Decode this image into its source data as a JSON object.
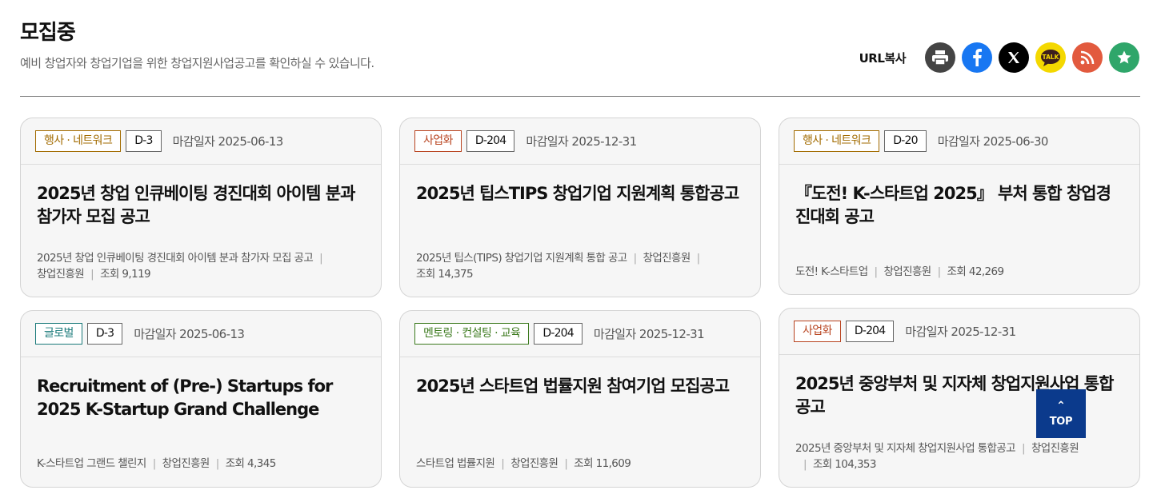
{
  "page": {
    "title": "모집중",
    "description": "예비 창업자와 창업기업을 위한 창업지원사업공고를 확인하실 수 있습니다."
  },
  "share": {
    "url_copy_label": "URL복사",
    "buttons": [
      {
        "icon": "print-icon",
        "color": "#444444"
      },
      {
        "icon": "facebook-icon",
        "color": "#1877f2"
      },
      {
        "icon": "x-icon",
        "color": "#000000"
      },
      {
        "icon": "kakaotalk-icon",
        "color": "#f4d800",
        "text": "TALK"
      },
      {
        "icon": "rss-icon",
        "color": "#e25a3e"
      },
      {
        "icon": "star-icon",
        "color": "#2fa66a"
      }
    ]
  },
  "cards": [
    {
      "category": "행사 · 네트워크",
      "category_color": "#a26b00",
      "dday": "D-3",
      "deadline": "마감일자 2025-06-13",
      "title": "2025년 창업 인큐베이팅 경진대회 아이템 분과 참가자 모집 공고",
      "meta_lines": [
        [
          "2025년 창업 인큐베이팅 경진대회 아이템 분과 참가자 모집 공고"
        ],
        [
          "창업진흥원",
          "조회 9,119"
        ]
      ]
    },
    {
      "category": "사업화",
      "category_color": "#b8431f",
      "dday": "D-204",
      "deadline": "마감일자 2025-12-31",
      "title": "2025년 팁스TIPS 창업기업 지원계획 통합공고",
      "meta_lines": [
        [
          "2025년 팁스(TIPS) 창업기업 지원계획 통합 공고",
          "창업진흥원"
        ],
        [
          "조회 14,375"
        ]
      ]
    },
    {
      "category": "행사 · 네트워크",
      "category_color": "#a26b00",
      "dday": "D-20",
      "deadline": "마감일자 2025-06-30",
      "title": "『도전! K-스타트업 2025』 부처 통합 창업경진대회 공고",
      "meta_lines": [
        [
          "도전! K-스타트업",
          "창업진흥원",
          "조회 42,269"
        ]
      ]
    },
    {
      "category": "글로벌",
      "category_color": "#1a7a7a",
      "dday": "D-3",
      "deadline": "마감일자 2025-06-13",
      "title": "Recruitment of (Pre-) Startups for 2025 K-Startup Grand Challenge",
      "meta_lines": [
        [
          "K-스타트업 그랜드 챌린지",
          "창업진흥원",
          "조회 4,345"
        ]
      ]
    },
    {
      "category": "멘토링 · 컨설팅 · 교육",
      "category_color": "#3c7a1e",
      "dday": "D-204",
      "deadline": "마감일자 2025-12-31",
      "title": "2025년 스타트업 법률지원 참여기업 모집공고",
      "meta_lines": [
        [
          "스타트업 법률지원",
          "창업진흥원",
          "조회 11,609"
        ]
      ]
    },
    {
      "category": "사업화",
      "category_color": "#b8431f",
      "dday": "D-204",
      "deadline": "마감일자 2025-12-31",
      "title": "2025년 중앙부처 및 지자체 창업지원사업 통합공고",
      "meta_lines": [
        [
          "2025년 중앙부처 및 지자체 창업지원사업 통합공고",
          "창업진흥원"
        ],
        [
          "조회 104,353"
        ]
      ]
    }
  ],
  "top_button": {
    "label": "TOP",
    "arrow": "⌃"
  }
}
